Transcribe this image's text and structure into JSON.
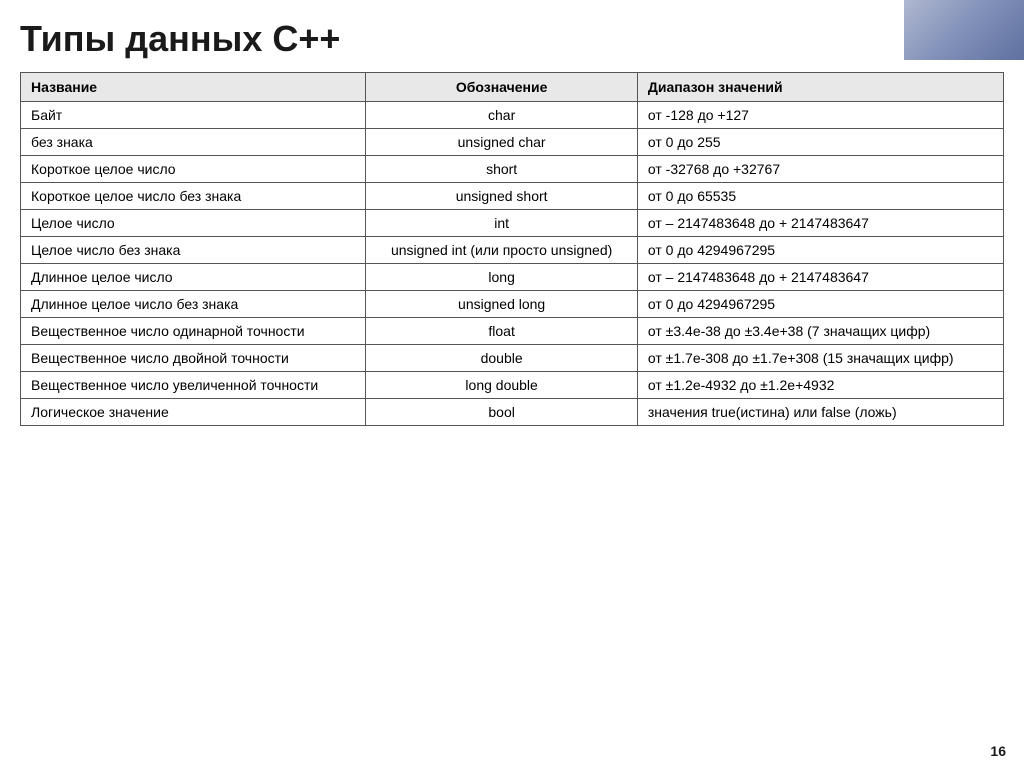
{
  "title": "Типы данных С++",
  "page_number": "16",
  "table": {
    "headers": [
      "Название",
      "Обозначение",
      "Диапазон значений"
    ],
    "rows": [
      {
        "name": "Байт",
        "designation": "char",
        "range": "от -128 до +127"
      },
      {
        "name": "без знака",
        "designation": "unsigned char",
        "range": "от 0 до 255"
      },
      {
        "name": "Короткое целое число",
        "designation": "short",
        "range": "от -32768 до +32767"
      },
      {
        "name": "Короткое целое число без знака",
        "designation": "unsigned short",
        "range": "от 0 до 65535"
      },
      {
        "name": "Целое число",
        "designation": "int",
        "range": "от – 2147483648 до + 2147483647"
      },
      {
        "name": "Целое число без знака",
        "designation": "unsigned int (или просто unsigned)",
        "range": "от 0 до 4294967295"
      },
      {
        "name": "Длинное целое число",
        "designation": "long",
        "range": "от – 2147483648 до + 2147483647"
      },
      {
        "name": "Длинное целое число без знака",
        "designation": "unsigned long",
        "range": "от 0 до 4294967295"
      },
      {
        "name": "Вещественное число одинарной точности",
        "designation": "float",
        "range": "от ±3.4е-38 до ±3.4е+38 (7 значащих цифр)"
      },
      {
        "name": "Вещественное число двойной точности",
        "designation": "double",
        "range": "от ±1.7е-308 до ±1.7е+308 (15 значащих цифр)"
      },
      {
        "name": "Вещественное число увеличенной точности",
        "designation": "long double",
        "range": "от ±1.2е-4932 до ±1.2е+4932"
      },
      {
        "name": "Логическое значение",
        "designation": "bool",
        "range": "значения true(истина) или false (ложь)"
      }
    ]
  }
}
